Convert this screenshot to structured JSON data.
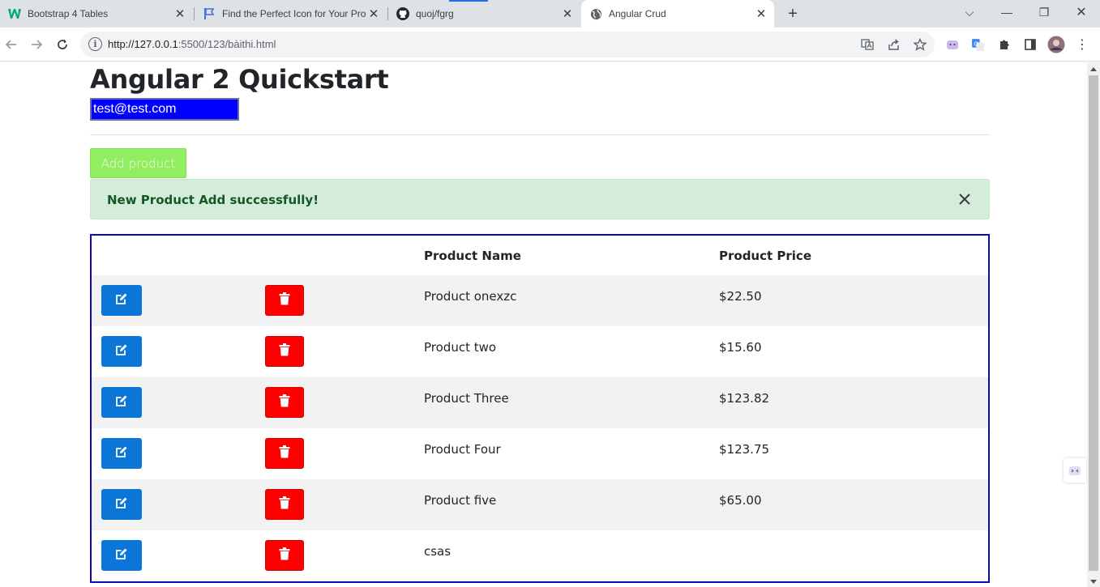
{
  "browser": {
    "tabs": [
      {
        "title": "Bootstrap 4 Tables",
        "icon": "w3schools-icon",
        "active": false
      },
      {
        "title": "Find the Perfect Icon for Your Pro",
        "icon": "flag-icon",
        "active": false
      },
      {
        "title": "quoj/fgrg",
        "icon": "github-icon",
        "active": false
      },
      {
        "title": "Angular Crud",
        "icon": "globe-icon",
        "active": true
      }
    ],
    "url_host": "http://127.0.0.1",
    "url_path": ":5500/123/bàithi.html"
  },
  "page": {
    "title": "Angular 2 Quickstart",
    "email_value": "test@test.com",
    "add_button_label": "Add product",
    "alert_message": "New Product Add successfully!",
    "alert_close_glyph": "×"
  },
  "table": {
    "headers": [
      "",
      "",
      "Product Name",
      "Product Price"
    ],
    "rows": [
      {
        "name": "Product onexzc",
        "price": "$22.50"
      },
      {
        "name": "Product two",
        "price": "$15.60"
      },
      {
        "name": "Product Three",
        "price": "$123.82"
      },
      {
        "name": "Product Four",
        "price": "$123.75"
      },
      {
        "name": "Product five",
        "price": "$65.00"
      },
      {
        "name": "csas",
        "price": ""
      }
    ]
  },
  "colors": {
    "accent_blue": "#0b76d8",
    "danger_red": "#ff0000",
    "success_green": "#90ee60",
    "alert_bg": "#d4edda",
    "table_border": "#0a0ab2",
    "email_bg": "#0000ff"
  }
}
